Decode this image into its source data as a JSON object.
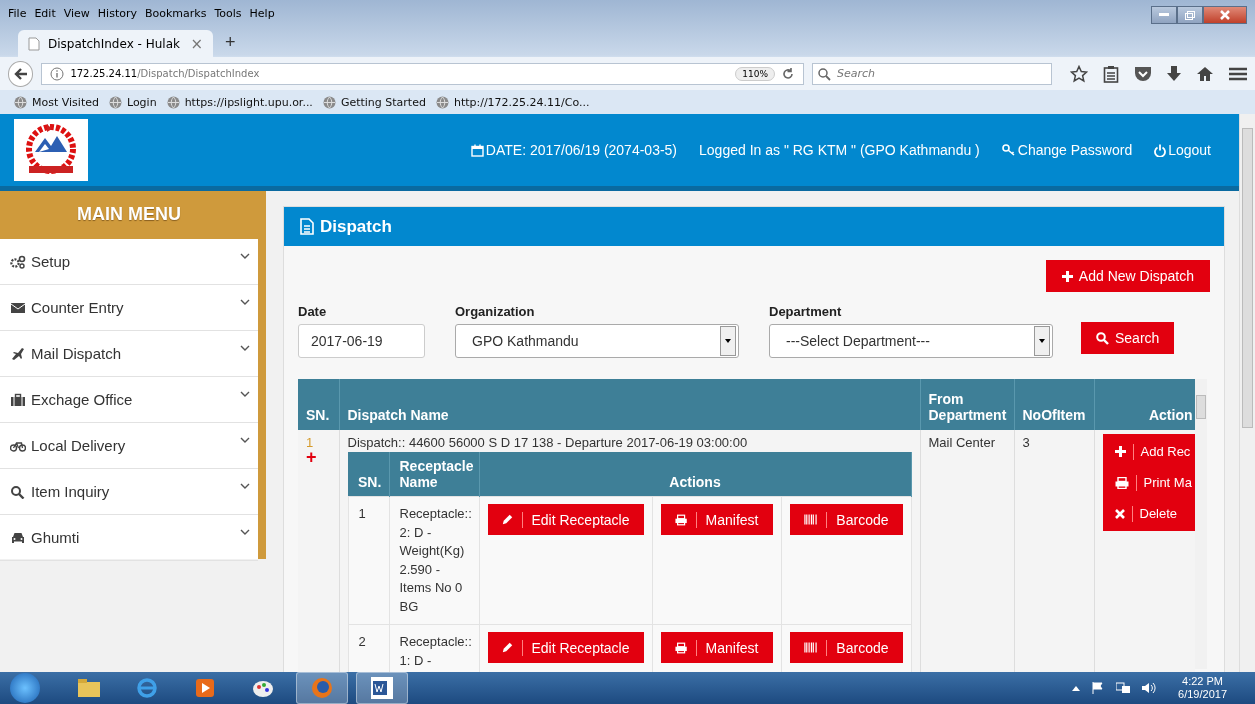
{
  "browser": {
    "menu": [
      "File",
      "Edit",
      "View",
      "History",
      "Bookmarks",
      "Tools",
      "Help"
    ],
    "tab": {
      "title": "DispatchIndex - Hulak",
      "close": "×",
      "new_tab": "+"
    },
    "address": {
      "host": "172.25.24.11",
      "path": "/Dispatch/DispatchIndex",
      "zoom": "110%"
    },
    "search": {
      "placeholder": "Search"
    },
    "bookmarks": [
      "Most Visited",
      "Login",
      "https://ipslight.upu.or...",
      "Getting Started",
      "http://172.25.24.11/Co..."
    ]
  },
  "header": {
    "date": "DATE: 2017/06/19 (2074-03-5)",
    "user": "Logged In as \" RG KTM \" (GPO Kathmandu )",
    "change_password": "Change Password",
    "logout": "Logout"
  },
  "sidebar": {
    "title": "MAIN MENU",
    "items": [
      {
        "label": "Setup"
      },
      {
        "label": "Counter Entry"
      },
      {
        "label": "Mail Dispatch"
      },
      {
        "label": "Exchage Office"
      },
      {
        "label": "Local Delivery"
      },
      {
        "label": "Item Inquiry"
      },
      {
        "label": "Ghumti"
      }
    ]
  },
  "panel": {
    "title": "Dispatch",
    "add_button": "Add New Dispatch",
    "filters": {
      "date": {
        "label": "Date",
        "value": "2017-06-19"
      },
      "organization": {
        "label": "Organization",
        "value": "GPO Kathmandu"
      },
      "department": {
        "label": "Department",
        "value": "---Select Department---"
      },
      "search_button": "Search"
    },
    "table": {
      "columns": [
        "SN.",
        "Dispatch Name",
        "From Department",
        "NoOfItem",
        "Action"
      ],
      "rows": [
        {
          "sn": "1",
          "expand": "+",
          "dispatch_name": "Dispatch:: 44600 56000 S D 17 138 - Departure 2017-06-19 03:00:00",
          "from_department": "Mail Center",
          "no_of_item": "3",
          "actions": [
            {
              "kind": "add",
              "label": "Add Rec"
            },
            {
              "kind": "print",
              "label": "Print Ma"
            },
            {
              "kind": "delete",
              "label": "Delete"
            }
          ],
          "receptacles": {
            "columns": [
              "SN.",
              "Receptacle Name",
              "Actions"
            ],
            "rows": [
              {
                "sn": "1",
                "name": "Receptacle:: 2: D - Weight(Kg) 2.590 - Items No 0 BG",
                "actions": [
                  {
                    "kind": "edit",
                    "label": "Edit Receptacle"
                  },
                  {
                    "kind": "print",
                    "label": "Manifest"
                  },
                  {
                    "kind": "barcode",
                    "label": "Barcode"
                  }
                ]
              },
              {
                "sn": "2",
                "name": "Receptacle:: 1: D -",
                "actions": [
                  {
                    "kind": "edit",
                    "label": "Edit Receptacle"
                  },
                  {
                    "kind": "print",
                    "label": "Manifest"
                  },
                  {
                    "kind": "barcode",
                    "label": "Barcode"
                  }
                ]
              }
            ]
          }
        }
      ]
    }
  },
  "taskbar": {
    "time": "4:22 PM",
    "date": "6/19/2017"
  }
}
